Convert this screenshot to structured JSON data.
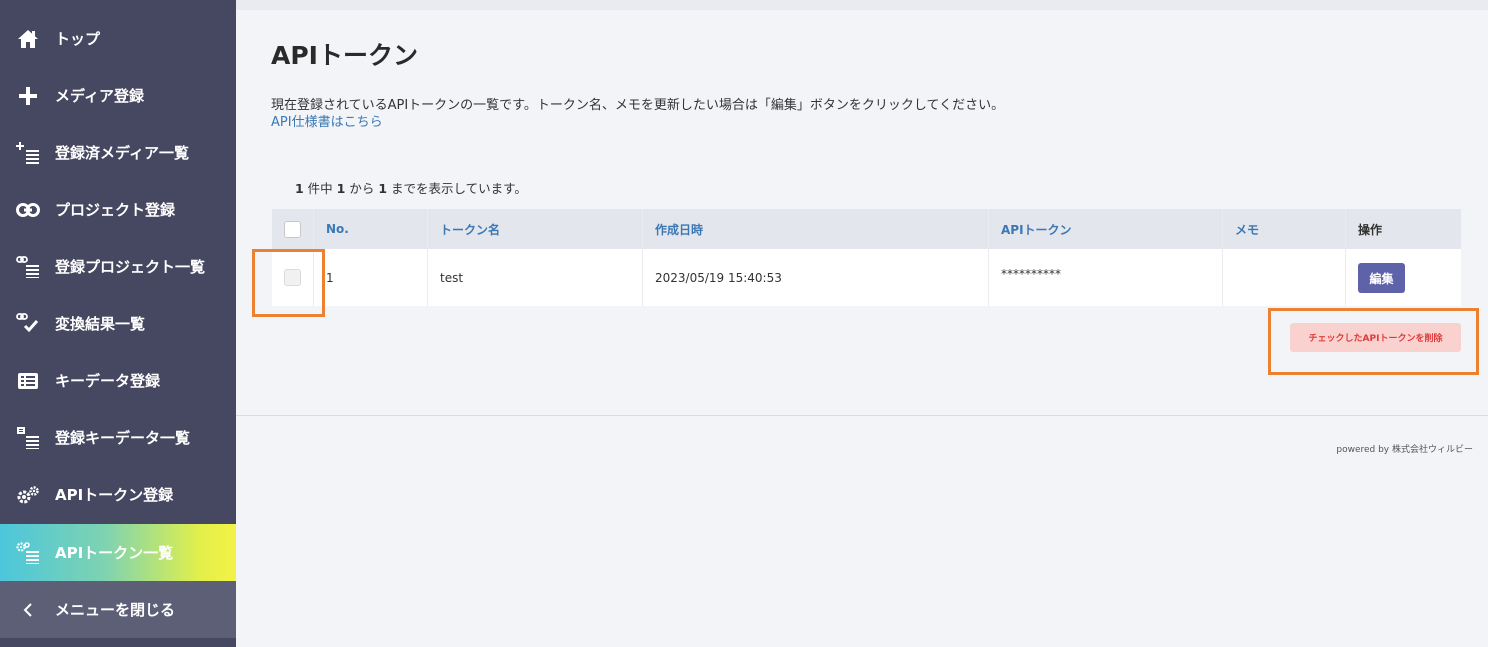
{
  "sidebar": {
    "items": [
      {
        "label": "トップ",
        "icon": "home-icon"
      },
      {
        "label": "メディア登録",
        "icon": "plus-icon"
      },
      {
        "label": "登録済メディア一覧",
        "icon": "plus-list-icon"
      },
      {
        "label": "プロジェクト登録",
        "icon": "link-icon"
      },
      {
        "label": "登録プロジェクト一覧",
        "icon": "link-list-icon"
      },
      {
        "label": "変換結果一覧",
        "icon": "link-check-icon"
      },
      {
        "label": "キーデータ登録",
        "icon": "id-card-icon"
      },
      {
        "label": "登録キーデータ一覧",
        "icon": "card-list-icon"
      },
      {
        "label": "APIトークン登録",
        "icon": "gears-icon"
      },
      {
        "label": "APIトークン一覧",
        "icon": "gears-list-icon",
        "active": true
      }
    ],
    "close_label": "メニューを閉じる"
  },
  "page": {
    "title": "APIトークン",
    "description": "現在登録されているAPIトークンの一覧です。トークン名、メモを更新したい場合は「編集」ボタンをクリックしてください。",
    "spec_link": "API仕様書はこちら"
  },
  "count": {
    "total": "1",
    "text1": " 件中 ",
    "from": "1",
    "text2": " から ",
    "to": "1",
    "text3": " までを表示しています。"
  },
  "table": {
    "headers": {
      "no": "No.",
      "name": "トークン名",
      "created": "作成日時",
      "token": "APIトークン",
      "memo": "メモ",
      "action": "操作"
    },
    "rows": [
      {
        "no": "1",
        "name": "test",
        "created": "2023/05/19 15:40:53",
        "token": "**********",
        "memo": "",
        "edit_label": "編集"
      }
    ]
  },
  "delete_button": "チェックしたAPIトークンを削除",
  "footer": {
    "powered": "powered by 株式会社ウィルビー"
  },
  "colors": {
    "sidebar_bg": "#464861",
    "accent": "#5e62a8",
    "link": "#3c78b4",
    "highlight": "#ec8132",
    "delete_bg": "#f9d2d0",
    "delete_text": "#e03a3a"
  }
}
